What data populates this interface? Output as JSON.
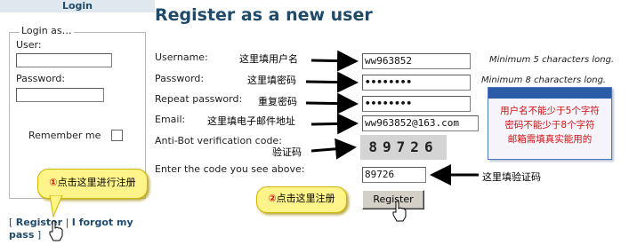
{
  "login": {
    "header": "Login",
    "legend": "Login as…",
    "user_label": "User:",
    "password_label": "Password:",
    "remember_label": "Remember me",
    "register_link": "Register",
    "forgot_link": "I forgot my pass"
  },
  "main": {
    "title": "Register as a new user",
    "username_label": "Username:",
    "username_value": "ww963852",
    "username_hint": "Minimum 5 characters long.",
    "password_label": "Password:",
    "password_value": "••••••••",
    "password_hint": "Minimum 8 characters long.",
    "repeat_label": "Repeat password:",
    "repeat_value": "••••••••",
    "email_label": "Email:",
    "email_value": "ww963852@163.com",
    "antibot_label": "Anti-Bot verification code:",
    "captcha_text": "89726",
    "code_label": "Enter the code you see above:",
    "code_value": "89726",
    "register_button": "Register"
  },
  "annotations": {
    "username": "这里填用户名",
    "password": "这里填密码",
    "repeat": "重复密码",
    "email": "这里填电子邮件地址",
    "captcha": "验证码",
    "code": "这里填验证码",
    "info_line1": "用户名不能少于5个字符",
    "info_line2": "密码不能少于8个字符",
    "info_line3": "邮箱需填真实能用的",
    "callout1_num": "①",
    "callout1_text": "点击这里进行注册",
    "callout2_num": "②",
    "callout2_text": "点击这里注册"
  },
  "colors": {
    "title": "#1f4a6a",
    "annotation_red": "#d01010",
    "callout_bg": "#fff48a",
    "info_bar": "#2a5ca8"
  }
}
